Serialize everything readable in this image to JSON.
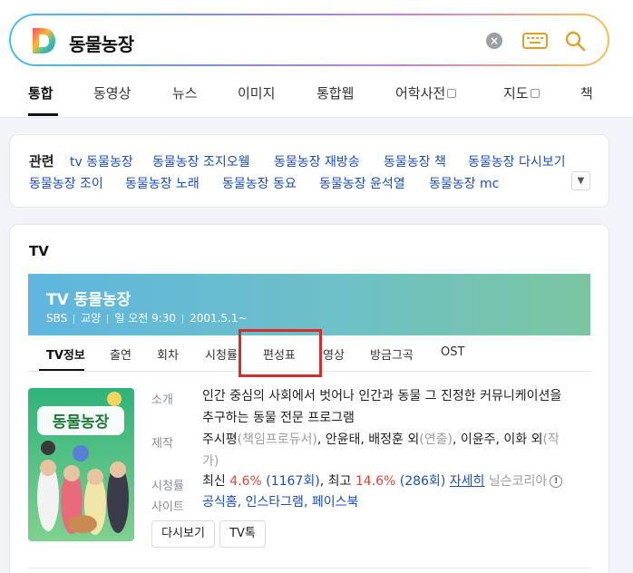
{
  "search": {
    "query": "동물농장",
    "logo_letter": "D"
  },
  "tabs": [
    {
      "label": "통합",
      "active": true
    },
    {
      "label": "동영상"
    },
    {
      "label": "뉴스"
    },
    {
      "label": "이미지"
    },
    {
      "label": "통합웹"
    },
    {
      "label": "어학사전",
      "external": true
    },
    {
      "label": "지도",
      "external": true
    },
    {
      "label": "책"
    }
  ],
  "related": {
    "title": "관련",
    "links": [
      "tv 동물농장",
      "동물농장 조지오웰",
      "동물농장 재방송",
      "동물농장 책",
      "동물농장 다시보기",
      "동물농장 조이",
      "동물농장 노래",
      "동물농장 동요",
      "동물농장 윤석열",
      "동물농장 mc"
    ]
  },
  "tv": {
    "heading": "TV",
    "title": "TV 동물농장",
    "meta": [
      "SBS",
      "교양",
      "일 오전 9:30",
      "2001.5.1~"
    ],
    "subtabs": [
      "TV정보",
      "출연",
      "회차",
      "시청률",
      "편성표",
      "영상",
      "방금그곡",
      "OST"
    ],
    "active_subtab": "TV정보",
    "highlighted_subtab": "편성표",
    "info": {
      "desc_label": "소개",
      "desc_line1": "인간 중심의 사회에서 벗어나 인간과 동물 그 진정한 커뮤니케이션을",
      "desc_line2": "추구하는 동물 전문 프로그램",
      "prod_label": "제작",
      "prod_p1": "주시평",
      "prod_r1": "(책임프로듀서)",
      "prod_p2": ", 안윤태, 배정훈 외",
      "prod_r2": "(연출)",
      "prod_p3": ", 이윤주, 이화 외",
      "prod_r3a": "(작",
      "prod_r3b": "가)",
      "rating_label": "시청률",
      "rating_latest_label": "최신",
      "rating_latest": "4.6%",
      "rating_latest_ep": "(1167회)",
      "rating_max_label": ", 최고",
      "rating_max": "14.6%",
      "rating_max_ep": "(286회)",
      "rating_more": "자세히",
      "rating_source": "닐슨코리아",
      "site_label": "사이트",
      "sites": "공식홈, 인스타그램, 페이스북"
    },
    "buttons": [
      "다시보기",
      "TV톡"
    ],
    "poster_text": "동물농장"
  },
  "colors": {
    "accent_blue": "#1a4dbd",
    "rating_red": "#e0433a",
    "banner_start": "#5fb6de",
    "banner_end": "#7bc6a0",
    "highlight": "#d92b2b"
  }
}
